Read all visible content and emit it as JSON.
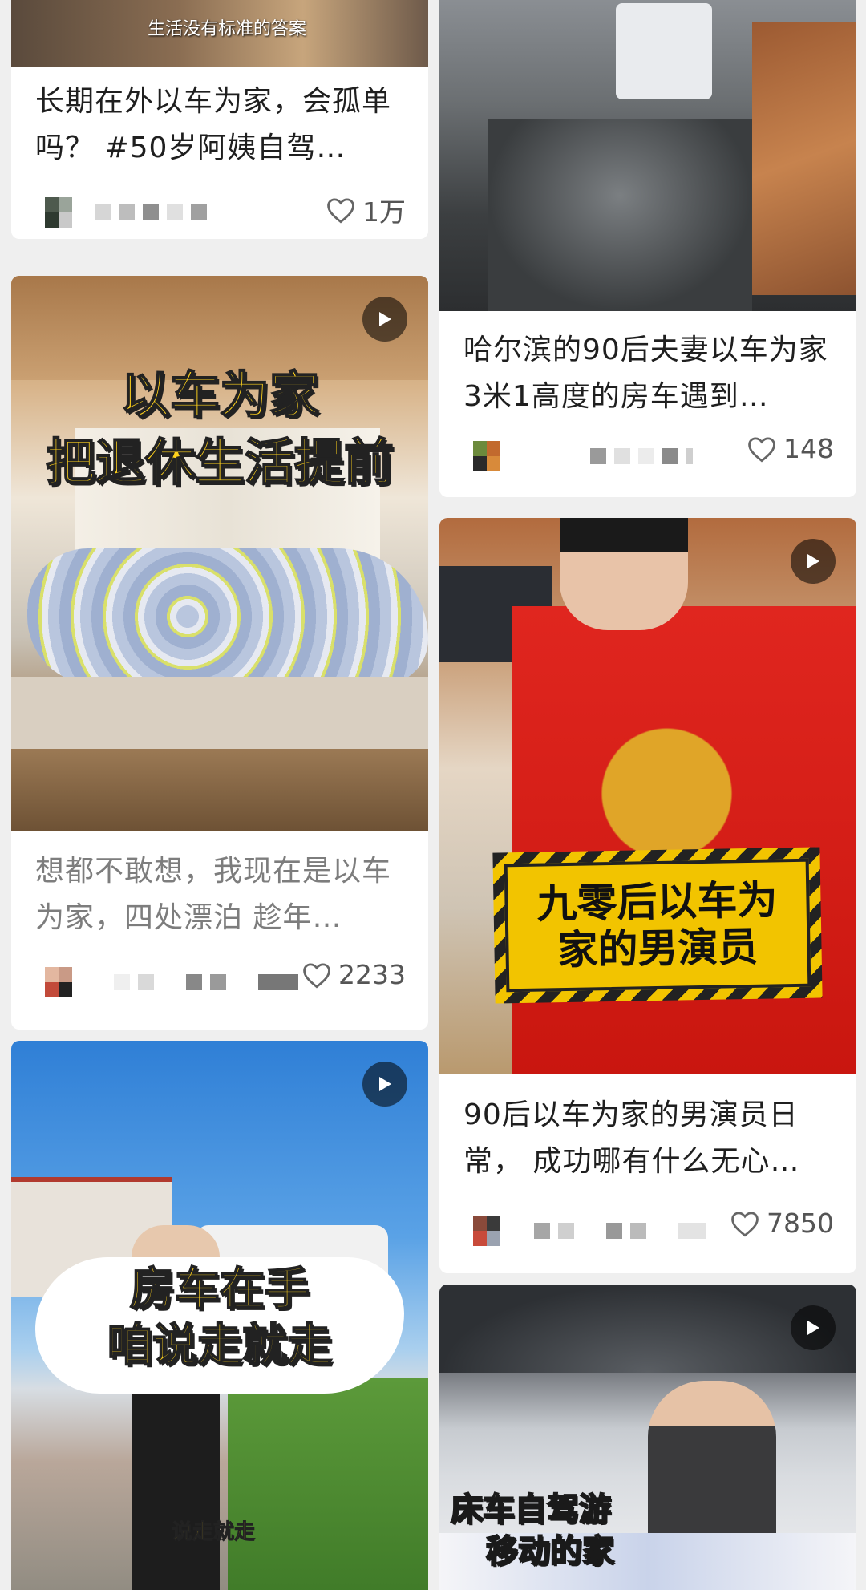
{
  "cards": [
    {
      "thumb_caption": "生活没有标准的答案",
      "title": "长期在外以车为家，会孤单吗？ #50岁阿姨自驾…",
      "likes": "1万"
    },
    {
      "title": "哈尔滨的90后夫妻以车为家 3米1高度的房车遇到…",
      "likes": "148"
    },
    {
      "overlay_line1": "以车为家",
      "overlay_line2": "把退休生活提前",
      "title": "想都不敢想，我现在是以车为家，四处漂泊 趁年…",
      "likes": "2233"
    },
    {
      "overlay_line1": "九零后以车为",
      "overlay_line2": "家的男演员",
      "title": "90后以车为家的男演员日常， 成功哪有什么无心…",
      "likes": "7850"
    },
    {
      "overlay_line1": "房车在手",
      "overlay_line2": "咱说走就走",
      "subcaption": "说走就走"
    },
    {
      "overlay_line1": "床车自驾游",
      "overlay_line2": "移动的家"
    }
  ],
  "icons": {
    "play": "play-icon",
    "like": "heart-outline-icon"
  }
}
